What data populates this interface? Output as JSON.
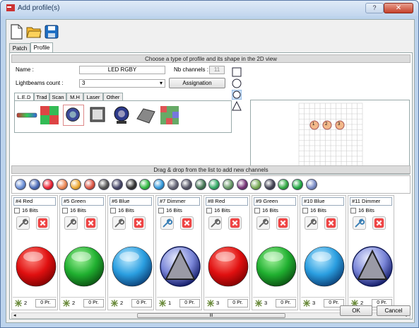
{
  "window": {
    "title": "Add profile(s)",
    "help_label": "?",
    "close_label": "✕"
  },
  "toolbar": {
    "items": [
      "new-file-icon",
      "open-folder-icon",
      "save-disk-icon"
    ]
  },
  "tabs": [
    {
      "label": "Patch",
      "active": false
    },
    {
      "label": "Profile",
      "active": true
    }
  ],
  "profile": {
    "section_title": "Choose a type of profile and its shape in the 2D view",
    "name_label": "Name :",
    "name_value": "LED RGBY",
    "nb_channels_label": "Nb channels :",
    "nb_channels_value": "11",
    "lightbeams_label": "Lightbeams count :",
    "lightbeams_value": "3",
    "assignation_label": "Assignation",
    "fixture_tabs": [
      "L.E.D",
      "Trad",
      "Scan",
      "M.H",
      "Laser",
      "Other"
    ],
    "active_fixture_tab": "L.E.D",
    "fixtures": [
      "led-bar-icon",
      "led-matrix-icon",
      "par-can-icon",
      "panel-icon",
      "moving-head-icon",
      "flood-icon",
      "pixel-panel-icon"
    ],
    "shapes": [
      "square-shape-icon",
      "circle-shape-icon",
      "circle-selected-shape-icon",
      "triangle-shape-icon"
    ],
    "preview_beams": [
      "1",
      "2",
      "3"
    ]
  },
  "channels_section": {
    "title": "Drag & drop from the list to add new channels",
    "palette": [
      {
        "name": "dimmer-blue-icon",
        "color": "#6a8fd8"
      },
      {
        "name": "dimmer-icon",
        "color": "#4a6ab8"
      },
      {
        "name": "red-icon",
        "color": "#e23"
      },
      {
        "name": "rgb-icon",
        "color": "#e85"
      },
      {
        "name": "amber-icon",
        "color": "#ea3"
      },
      {
        "name": "rgb-wheel-icon",
        "color": "#d54"
      },
      {
        "name": "gray-icon",
        "color": "#555"
      },
      {
        "name": "shutter-icon",
        "color": "#446"
      },
      {
        "name": "gobo-icon",
        "color": "#333"
      },
      {
        "name": "green-icon",
        "color": "#3b4"
      },
      {
        "name": "blue-icon",
        "color": "#39d"
      },
      {
        "name": "pan-icon",
        "color": "#667"
      },
      {
        "name": "tilt-icon",
        "color": "#556"
      },
      {
        "name": "gobo-wheel-icon",
        "color": "#475"
      },
      {
        "name": "prism-icon",
        "color": "#3a6"
      },
      {
        "name": "focus-icon",
        "color": "#696"
      },
      {
        "name": "iris-icon",
        "color": "#737"
      },
      {
        "name": "zoom-icon",
        "color": "#7a5"
      },
      {
        "name": "speed-icon",
        "color": "#445"
      },
      {
        "name": "macro-icon",
        "color": "#3a4"
      },
      {
        "name": "effect-icon",
        "color": "#2a4"
      },
      {
        "name": "unknown-icon",
        "color": "#7a8dc8"
      }
    ],
    "columns": [
      {
        "id": "#4",
        "name": "Red",
        "bits": "16 Bits",
        "ball": "red",
        "num": "2",
        "pr": "0 Pr."
      },
      {
        "id": "#5",
        "name": "Green",
        "bits": "16 Bits",
        "ball": "green",
        "num": "2",
        "pr": "0 Pr."
      },
      {
        "id": "#6",
        "name": "Blue",
        "bits": "16 Bits",
        "ball": "blue",
        "num": "2",
        "pr": "0 Pr."
      },
      {
        "id": "#7",
        "name": "Dimmer",
        "bits": "16 Bits",
        "ball": "dimmer",
        "num": "1",
        "pr": "0 Pr."
      },
      {
        "id": "#8",
        "name": "Red",
        "bits": "16 Bits",
        "ball": "red",
        "num": "3",
        "pr": "0 Pr."
      },
      {
        "id": "#9",
        "name": "Green",
        "bits": "16 Bits",
        "ball": "green",
        "num": "3",
        "pr": "0 Pr."
      },
      {
        "id": "#10",
        "name": "Blue",
        "bits": "16 Bits",
        "ball": "blue",
        "num": "3",
        "pr": "0 Pr."
      },
      {
        "id": "#11",
        "name": "Dimmer",
        "bits": "16 Bits",
        "ball": "dimmer",
        "num": "2",
        "pr": "0 Pr."
      }
    ],
    "scroll_grip": "III"
  },
  "footer": {
    "ok_label": "OK",
    "cancel_label": "Cancel"
  },
  "colors": {
    "window_frame": "#bcd3ec",
    "panel": "#f0f0f0",
    "red": "#e11",
    "green": "#1a3",
    "blue": "#29d",
    "dimmer": "#33a"
  }
}
